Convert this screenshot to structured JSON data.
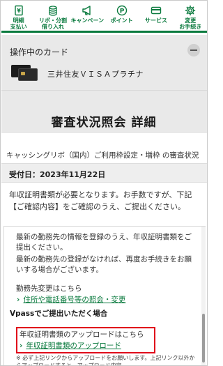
{
  "nav": {
    "items": [
      {
        "label": "明細\n支払い",
        "icon": "document-yen-icon"
      },
      {
        "label": "リボ・分割\n借り入れ",
        "icon": "coins-stack-icon"
      },
      {
        "label": "キャンペーン",
        "icon": "megaphone-icon"
      },
      {
        "label": "ポイント",
        "icon": "point-p-icon"
      },
      {
        "label": "サービス",
        "icon": "card-service-icon"
      },
      {
        "label": "変更\nお手続き",
        "icon": "gear-icon"
      }
    ],
    "accent": "#0a7a3e"
  },
  "card": {
    "heading": "操作中のカード",
    "name": "三井住友ＶＩＳＡプラチナ"
  },
  "page": {
    "title": "審査状況照会 詳細",
    "intro": "キャッシングリボ（国内）ご利用枠設定・増枠 の審査状況は以下のとおりです。"
  },
  "status": {
    "date": "受付日：2023年11月22日",
    "notice": "年収証明書類が必要となります。お手数ですが、下記【ご確認内容】をご確認のうえ、ご提出ください。"
  },
  "details": {
    "para1": "最新の勤務先の情報を登録のうえ、年収証明書類をご提出ください。",
    "para2": "最新の勤務先の登録がなければ、再度お手続きをお願いする場合がございます。",
    "workplace_change": "勤務先変更はこちら",
    "workplace_link": "住所や電話番号等の照会・変更",
    "vpass_heading": "Vpassでご提出いただく場合",
    "upload_heading": "年収証明書類のアップロードはこちら",
    "upload_link": "年収証明書類のアップロード",
    "note": "※ 必ず上記リンクからアップロードをお願いします。上記リンク以外からアップロードすると、アップロード内容"
  }
}
